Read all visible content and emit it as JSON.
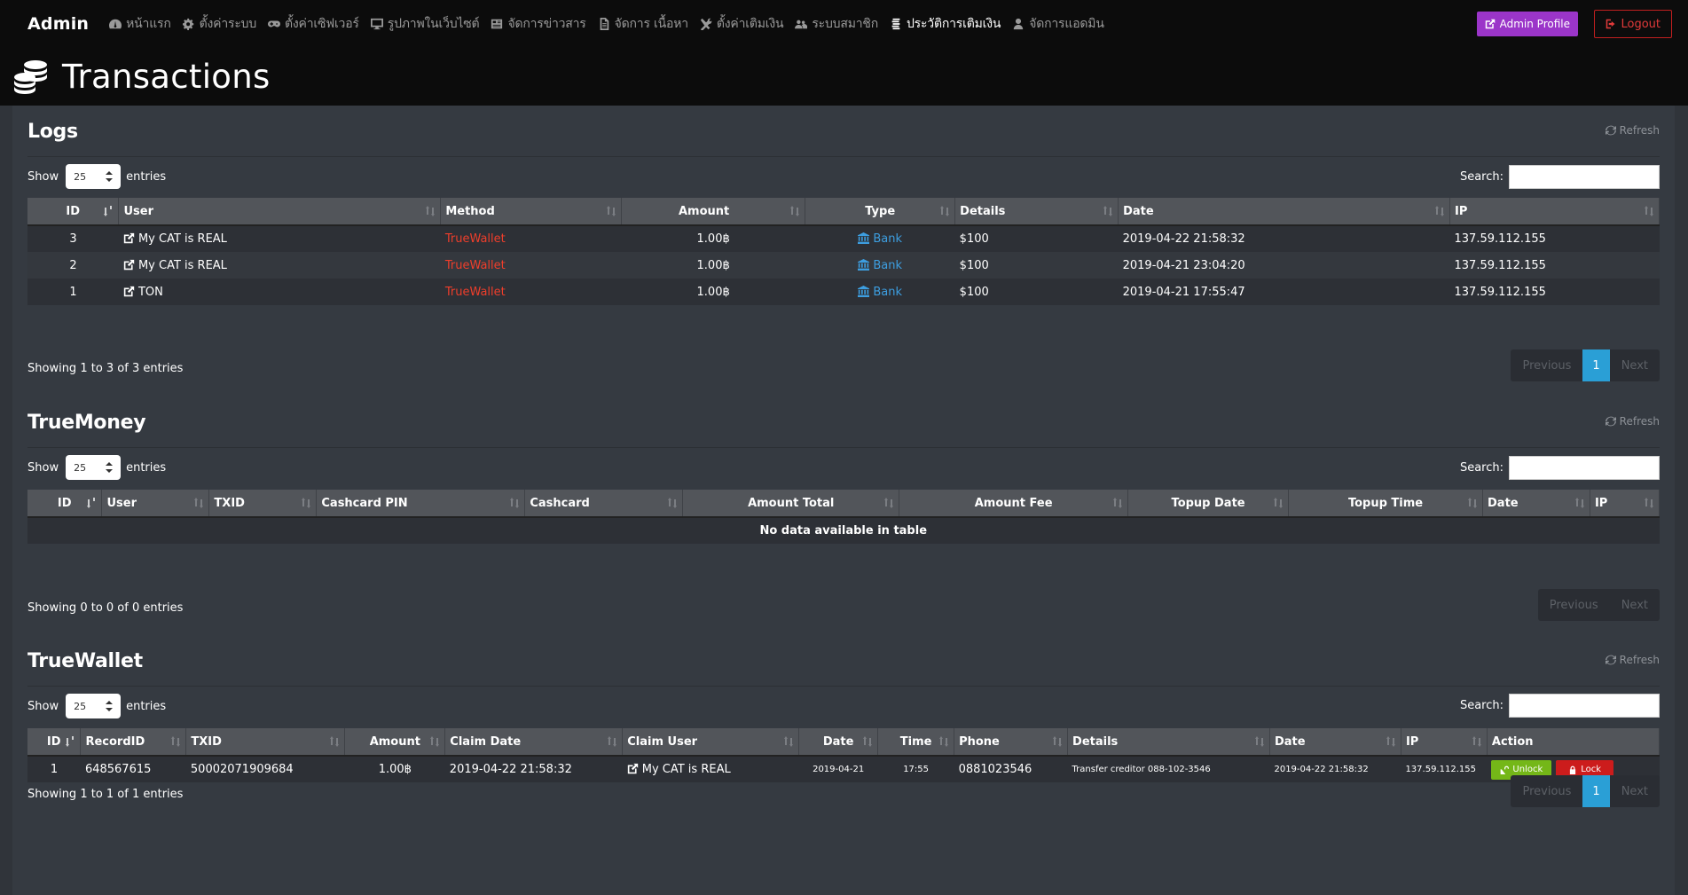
{
  "nav": {
    "brand": "Admin",
    "items": [
      {
        "label": "หน้าแรก",
        "icon": "dashboard-icon"
      },
      {
        "label": "ตั้งค่าระบบ",
        "icon": "gears-icon"
      },
      {
        "label": "ตั้งค่าเซิฟเวอร์",
        "icon": "gamepad-icon"
      },
      {
        "label": "รูปภาพในเว็บไซต์",
        "icon": "desktop-icon"
      },
      {
        "label": "จัดการข่าวสาร",
        "icon": "newspaper-icon"
      },
      {
        "label": "จัดการ เนื้อหา",
        "icon": "file-text-icon"
      },
      {
        "label": "ตั้งค่าเติมเงิน",
        "icon": "wrench-icon"
      },
      {
        "label": "ระบบสมาชิก",
        "icon": "users-icon"
      },
      {
        "label": "ประวัติการเติมเงิน",
        "icon": "coins-icon",
        "active": true
      },
      {
        "label": "จัดการแอดมิน",
        "icon": "user-secret-icon"
      }
    ],
    "profile_label": "Admin Profile",
    "logout_label": "Logout"
  },
  "page": {
    "title": "Transactions",
    "icon": "database-coins-icon"
  },
  "common": {
    "refresh_label": "Refresh",
    "show_label": "Show",
    "entries_label": "entries",
    "entries_value": "25",
    "search_label": "Search:",
    "previous_label": "Previous",
    "next_label": "Next",
    "page_number": "1"
  },
  "logs": {
    "title": "Logs",
    "columns": [
      "ID",
      "User",
      "Method",
      "Amount",
      "Type",
      "Details",
      "Date",
      "IP"
    ],
    "rows": [
      {
        "id": "3",
        "user": "My CAT is REAL",
        "method": "TrueWallet",
        "amount": "1.00฿",
        "type": "Bank",
        "details": "$100",
        "date": "2019-04-22 21:58:32",
        "ip": "137.59.112.155"
      },
      {
        "id": "2",
        "user": "My CAT is REAL",
        "method": "TrueWallet",
        "amount": "1.00฿",
        "type": "Bank",
        "details": "$100",
        "date": "2019-04-21 23:04:20",
        "ip": "137.59.112.155"
      },
      {
        "id": "1",
        "user": "TON",
        "method": "TrueWallet",
        "amount": "1.00฿",
        "type": "Bank",
        "details": "$100",
        "date": "2019-04-21 17:55:47",
        "ip": "137.59.112.155"
      }
    ],
    "info": "Showing 1 to 3 of 3 entries"
  },
  "truemoney": {
    "title": "TrueMoney",
    "columns": [
      "ID",
      "User",
      "TXID",
      "Cashcard PIN",
      "Cashcard",
      "Amount Total",
      "Amount Fee",
      "Topup Date",
      "Topup Time",
      "Date",
      "IP"
    ],
    "empty": "No data available in table",
    "info": "Showing 0 to 0 of 0 entries"
  },
  "truewallet": {
    "title": "TrueWallet",
    "columns": [
      "ID",
      "RecordID",
      "TXID",
      "Amount",
      "Claim Date",
      "Claim User",
      "Date",
      "Time",
      "Phone",
      "Details",
      "Date",
      "IP",
      "Action"
    ],
    "rows": [
      {
        "id": "1",
        "record_id": "648567615",
        "txid": "50002071909684",
        "amount": "1.00฿",
        "claim_date": "2019-04-22 21:58:32",
        "claim_user": "My CAT is REAL",
        "date": "2019-04-21",
        "time": "17:55",
        "phone": "0881023546",
        "details": "Transfer creditor 088-102-3546",
        "date2": "2019-04-22 21:58:32",
        "ip": "137.59.112.155",
        "unlock_label": "Unlock",
        "lock_label": "Lock"
      }
    ],
    "info": "Showing 1 to 1 of 1 entries"
  },
  "colors": {
    "accent": "#2a9fd6",
    "profile": "#9b35c9",
    "logout": "#c01f1f",
    "unlock": "#74b718",
    "lock": "#cc1c1c",
    "method": "#ef3e2b",
    "bank": "#3d9ee0"
  }
}
